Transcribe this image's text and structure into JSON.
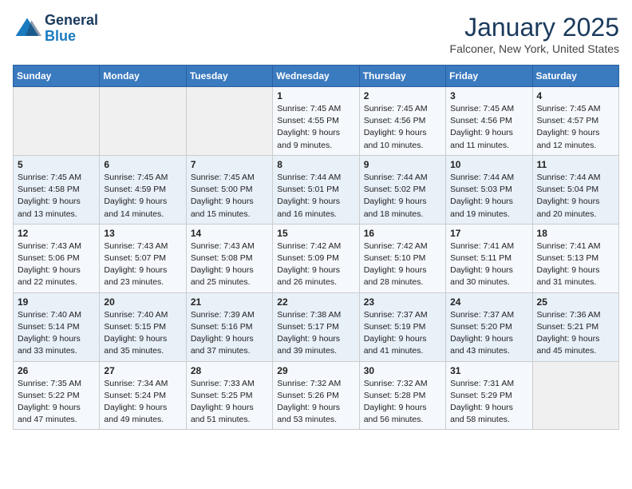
{
  "header": {
    "logo_line1": "General",
    "logo_line2": "Blue",
    "month": "January 2025",
    "location": "Falconer, New York, United States"
  },
  "days_of_week": [
    "Sunday",
    "Monday",
    "Tuesday",
    "Wednesday",
    "Thursday",
    "Friday",
    "Saturday"
  ],
  "weeks": [
    [
      {
        "day": "",
        "sunrise": "",
        "sunset": "",
        "daylight": ""
      },
      {
        "day": "",
        "sunrise": "",
        "sunset": "",
        "daylight": ""
      },
      {
        "day": "",
        "sunrise": "",
        "sunset": "",
        "daylight": ""
      },
      {
        "day": "1",
        "sunrise": "Sunrise: 7:45 AM",
        "sunset": "Sunset: 4:55 PM",
        "daylight": "Daylight: 9 hours and 9 minutes."
      },
      {
        "day": "2",
        "sunrise": "Sunrise: 7:45 AM",
        "sunset": "Sunset: 4:56 PM",
        "daylight": "Daylight: 9 hours and 10 minutes."
      },
      {
        "day": "3",
        "sunrise": "Sunrise: 7:45 AM",
        "sunset": "Sunset: 4:56 PM",
        "daylight": "Daylight: 9 hours and 11 minutes."
      },
      {
        "day": "4",
        "sunrise": "Sunrise: 7:45 AM",
        "sunset": "Sunset: 4:57 PM",
        "daylight": "Daylight: 9 hours and 12 minutes."
      }
    ],
    [
      {
        "day": "5",
        "sunrise": "Sunrise: 7:45 AM",
        "sunset": "Sunset: 4:58 PM",
        "daylight": "Daylight: 9 hours and 13 minutes."
      },
      {
        "day": "6",
        "sunrise": "Sunrise: 7:45 AM",
        "sunset": "Sunset: 4:59 PM",
        "daylight": "Daylight: 9 hours and 14 minutes."
      },
      {
        "day": "7",
        "sunrise": "Sunrise: 7:45 AM",
        "sunset": "Sunset: 5:00 PM",
        "daylight": "Daylight: 9 hours and 15 minutes."
      },
      {
        "day": "8",
        "sunrise": "Sunrise: 7:44 AM",
        "sunset": "Sunset: 5:01 PM",
        "daylight": "Daylight: 9 hours and 16 minutes."
      },
      {
        "day": "9",
        "sunrise": "Sunrise: 7:44 AM",
        "sunset": "Sunset: 5:02 PM",
        "daylight": "Daylight: 9 hours and 18 minutes."
      },
      {
        "day": "10",
        "sunrise": "Sunrise: 7:44 AM",
        "sunset": "Sunset: 5:03 PM",
        "daylight": "Daylight: 9 hours and 19 minutes."
      },
      {
        "day": "11",
        "sunrise": "Sunrise: 7:44 AM",
        "sunset": "Sunset: 5:04 PM",
        "daylight": "Daylight: 9 hours and 20 minutes."
      }
    ],
    [
      {
        "day": "12",
        "sunrise": "Sunrise: 7:43 AM",
        "sunset": "Sunset: 5:06 PM",
        "daylight": "Daylight: 9 hours and 22 minutes."
      },
      {
        "day": "13",
        "sunrise": "Sunrise: 7:43 AM",
        "sunset": "Sunset: 5:07 PM",
        "daylight": "Daylight: 9 hours and 23 minutes."
      },
      {
        "day": "14",
        "sunrise": "Sunrise: 7:43 AM",
        "sunset": "Sunset: 5:08 PM",
        "daylight": "Daylight: 9 hours and 25 minutes."
      },
      {
        "day": "15",
        "sunrise": "Sunrise: 7:42 AM",
        "sunset": "Sunset: 5:09 PM",
        "daylight": "Daylight: 9 hours and 26 minutes."
      },
      {
        "day": "16",
        "sunrise": "Sunrise: 7:42 AM",
        "sunset": "Sunset: 5:10 PM",
        "daylight": "Daylight: 9 hours and 28 minutes."
      },
      {
        "day": "17",
        "sunrise": "Sunrise: 7:41 AM",
        "sunset": "Sunset: 5:11 PM",
        "daylight": "Daylight: 9 hours and 30 minutes."
      },
      {
        "day": "18",
        "sunrise": "Sunrise: 7:41 AM",
        "sunset": "Sunset: 5:13 PM",
        "daylight": "Daylight: 9 hours and 31 minutes."
      }
    ],
    [
      {
        "day": "19",
        "sunrise": "Sunrise: 7:40 AM",
        "sunset": "Sunset: 5:14 PM",
        "daylight": "Daylight: 9 hours and 33 minutes."
      },
      {
        "day": "20",
        "sunrise": "Sunrise: 7:40 AM",
        "sunset": "Sunset: 5:15 PM",
        "daylight": "Daylight: 9 hours and 35 minutes."
      },
      {
        "day": "21",
        "sunrise": "Sunrise: 7:39 AM",
        "sunset": "Sunset: 5:16 PM",
        "daylight": "Daylight: 9 hours and 37 minutes."
      },
      {
        "day": "22",
        "sunrise": "Sunrise: 7:38 AM",
        "sunset": "Sunset: 5:17 PM",
        "daylight": "Daylight: 9 hours and 39 minutes."
      },
      {
        "day": "23",
        "sunrise": "Sunrise: 7:37 AM",
        "sunset": "Sunset: 5:19 PM",
        "daylight": "Daylight: 9 hours and 41 minutes."
      },
      {
        "day": "24",
        "sunrise": "Sunrise: 7:37 AM",
        "sunset": "Sunset: 5:20 PM",
        "daylight": "Daylight: 9 hours and 43 minutes."
      },
      {
        "day": "25",
        "sunrise": "Sunrise: 7:36 AM",
        "sunset": "Sunset: 5:21 PM",
        "daylight": "Daylight: 9 hours and 45 minutes."
      }
    ],
    [
      {
        "day": "26",
        "sunrise": "Sunrise: 7:35 AM",
        "sunset": "Sunset: 5:22 PM",
        "daylight": "Daylight: 9 hours and 47 minutes."
      },
      {
        "day": "27",
        "sunrise": "Sunrise: 7:34 AM",
        "sunset": "Sunset: 5:24 PM",
        "daylight": "Daylight: 9 hours and 49 minutes."
      },
      {
        "day": "28",
        "sunrise": "Sunrise: 7:33 AM",
        "sunset": "Sunset: 5:25 PM",
        "daylight": "Daylight: 9 hours and 51 minutes."
      },
      {
        "day": "29",
        "sunrise": "Sunrise: 7:32 AM",
        "sunset": "Sunset: 5:26 PM",
        "daylight": "Daylight: 9 hours and 53 minutes."
      },
      {
        "day": "30",
        "sunrise": "Sunrise: 7:32 AM",
        "sunset": "Sunset: 5:28 PM",
        "daylight": "Daylight: 9 hours and 56 minutes."
      },
      {
        "day": "31",
        "sunrise": "Sunrise: 7:31 AM",
        "sunset": "Sunset: 5:29 PM",
        "daylight": "Daylight: 9 hours and 58 minutes."
      },
      {
        "day": "",
        "sunrise": "",
        "sunset": "",
        "daylight": ""
      }
    ]
  ]
}
